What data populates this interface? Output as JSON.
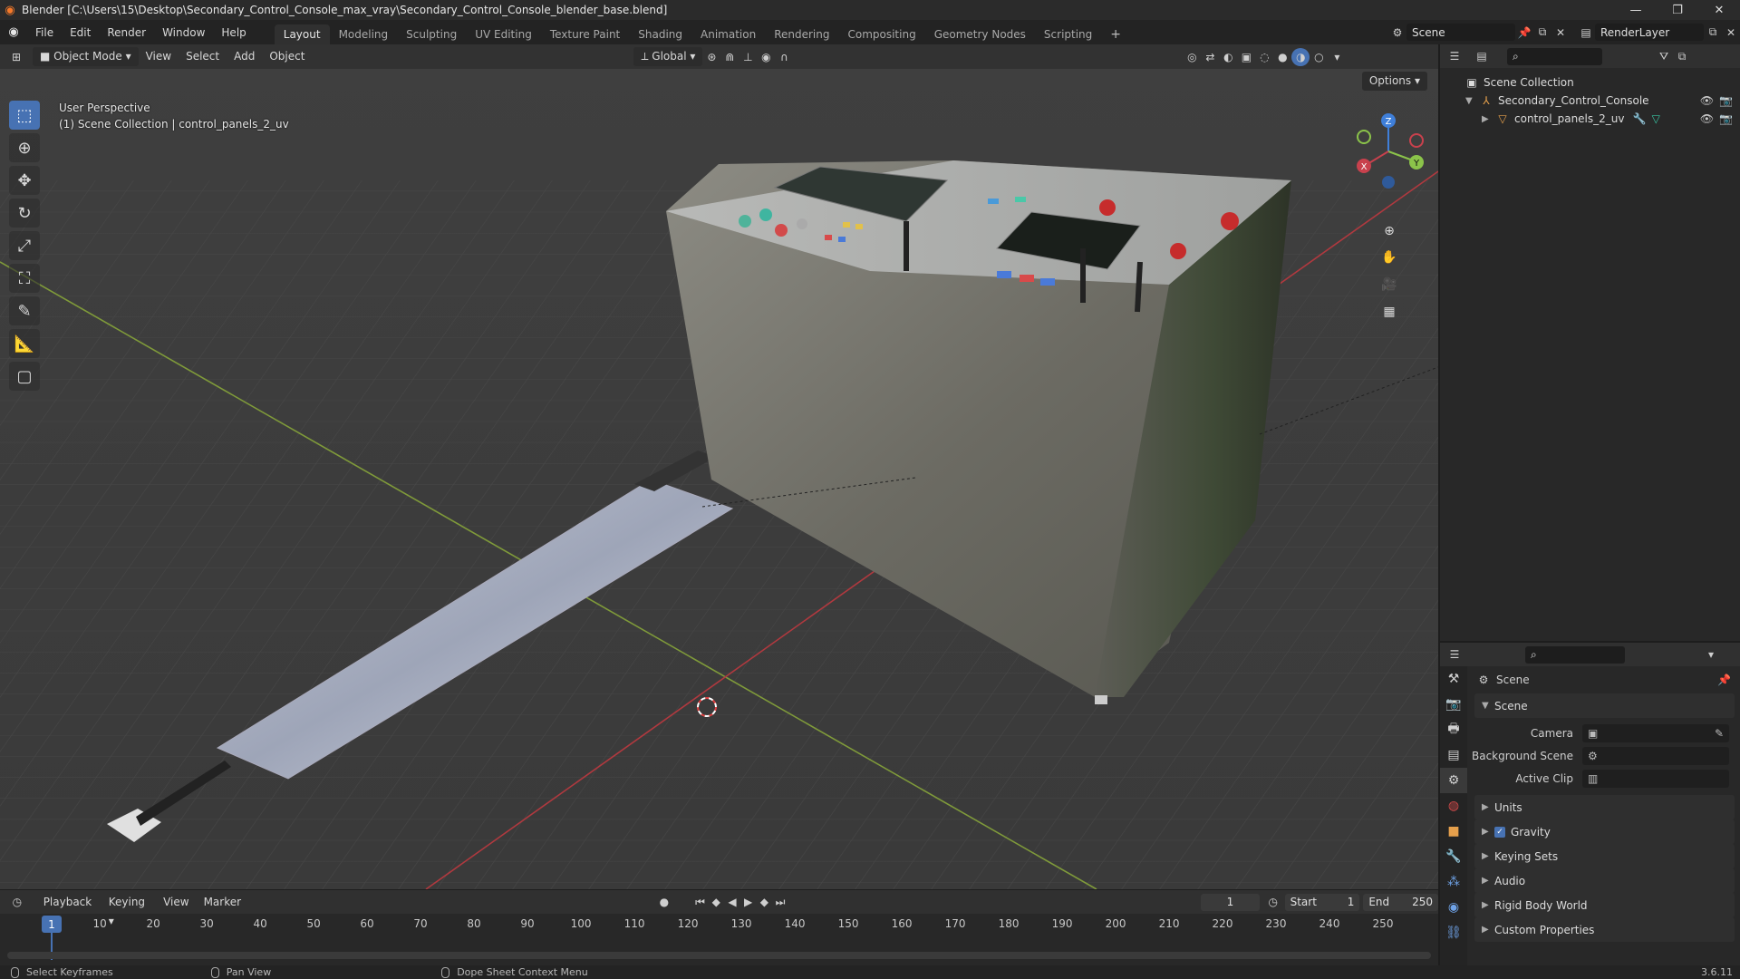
{
  "window": {
    "title": "Blender [C:\\Users\\15\\Desktop\\Secondary_Control_Console_max_vray\\Secondary_Control_Console_blender_base.blend]"
  },
  "menus": [
    "File",
    "Edit",
    "Render",
    "Window",
    "Help"
  ],
  "workspaces": {
    "tabs": [
      "Layout",
      "Modeling",
      "Sculpting",
      "UV Editing",
      "Texture Paint",
      "Shading",
      "Animation",
      "Rendering",
      "Compositing",
      "Geometry Nodes",
      "Scripting"
    ],
    "active": "Layout",
    "add": "+"
  },
  "scene_selector": {
    "scene": "Scene",
    "view_layer": "RenderLayer"
  },
  "viewport": {
    "mode": "Object Mode",
    "menus": [
      "View",
      "Select",
      "Add",
      "Object"
    ],
    "orientation": "Global",
    "options": "Options",
    "perspective": "User Perspective",
    "context": "(1) Scene Collection | control_panels_2_uv",
    "gizmo": {
      "z": "Z",
      "y": "Y",
      "x": "X"
    }
  },
  "outliner": {
    "root": "Scene Collection",
    "collection": "Secondary_Control_Console",
    "object": "control_panels_2_uv"
  },
  "properties": {
    "header": "Scene",
    "scene_section": "Scene",
    "fields": [
      {
        "label": "Camera"
      },
      {
        "label": "Background Scene"
      },
      {
        "label": "Active Clip"
      }
    ],
    "sections": [
      "Units",
      "Gravity",
      "Keying Sets",
      "Audio",
      "Rigid Body World",
      "Custom Properties"
    ],
    "gravity_enabled": true
  },
  "timeline": {
    "menus": [
      "Playback",
      "Keying",
      "View",
      "Marker"
    ],
    "current_frame": "1",
    "start_label": "Start",
    "start": "1",
    "end_label": "End",
    "end": "250",
    "ticks": [
      "1",
      "10",
      "20",
      "30",
      "40",
      "50",
      "60",
      "70",
      "80",
      "90",
      "100",
      "110",
      "120",
      "130",
      "140",
      "150",
      "160",
      "170",
      "180",
      "190",
      "200",
      "210",
      "220",
      "230",
      "240",
      "250"
    ]
  },
  "statusbar": {
    "items": [
      "Select Keyframes",
      "Pan View",
      "Dope Sheet Context Menu"
    ],
    "version": "3.6.11"
  },
  "colors": {
    "accent": "#4772b3",
    "x_axis": "#c8414d",
    "y_axis": "#8bc34a",
    "z_axis": "#3f7fd9"
  }
}
